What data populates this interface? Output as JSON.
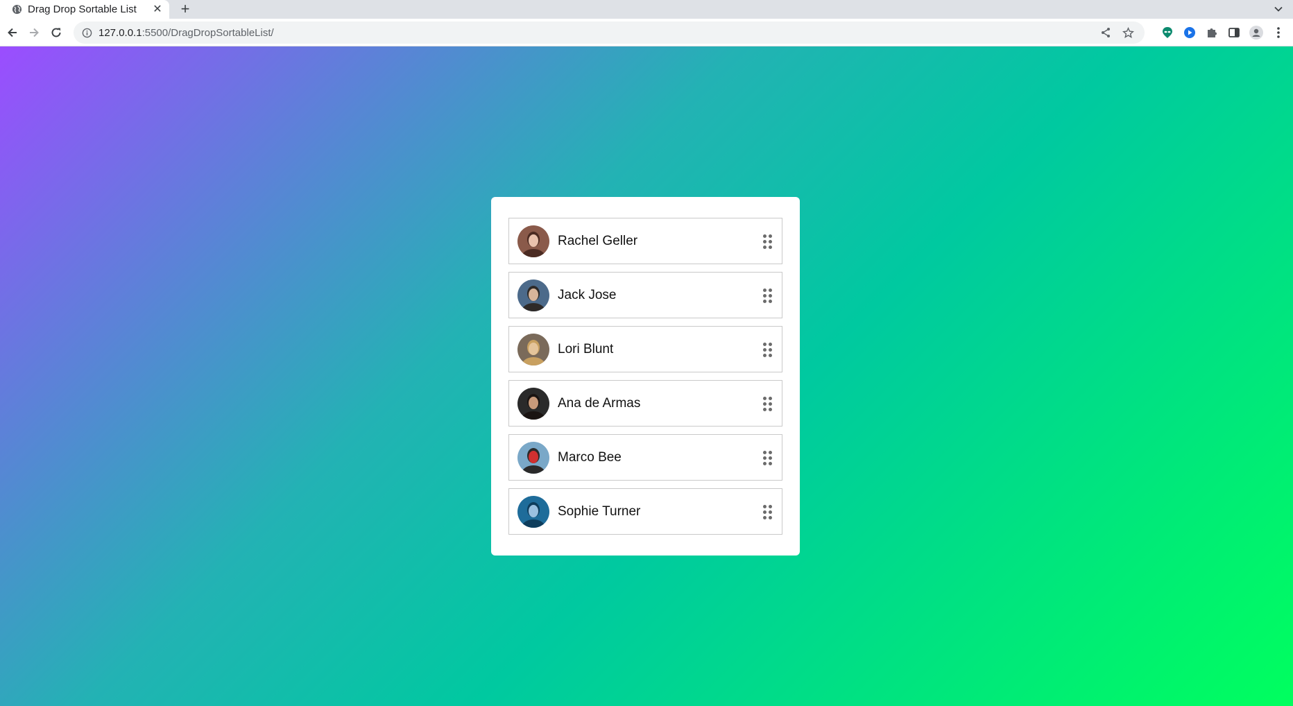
{
  "browser": {
    "tab": {
      "title": "Drag Drop Sortable List",
      "favicon": "globe-icon",
      "close_icon": "close-icon"
    },
    "new_tab_icon": "plus-icon",
    "tab_search_icon": "chevron-down-icon",
    "nav": {
      "back_icon": "arrow-left-icon",
      "forward_icon": "arrow-right-icon",
      "reload_icon": "reload-icon"
    },
    "omnibox": {
      "info_icon": "info-icon",
      "url_host": "127.0.0.1",
      "url_rest": ":5500/DragDropSortableList/",
      "share_icon": "share-icon",
      "star_icon": "star-icon"
    },
    "extensions": [
      "alien-extension-icon",
      "play-extension-icon",
      "puzzle-icon",
      "side-panel-icon",
      "profile-icon",
      "kebab-menu-icon"
    ]
  },
  "page": {
    "background_gradient": [
      "#9b4dff",
      "#23b2b4",
      "#00c9a0",
      "#00ff5e"
    ],
    "list": {
      "items": [
        {
          "name": "Rachel Geller",
          "avatar": "avatar-icon",
          "avatar_colors": [
            "#8a5a4a",
            "#e9c2ad",
            "#4b2b22"
          ]
        },
        {
          "name": "Jack Jose",
          "avatar": "avatar-icon",
          "avatar_colors": [
            "#4c6a8a",
            "#d8b59a",
            "#2e2a28"
          ]
        },
        {
          "name": "Lori Blunt",
          "avatar": "avatar-icon",
          "avatar_colors": [
            "#7a6a5a",
            "#e4c49a",
            "#c8a060"
          ]
        },
        {
          "name": "Ana de Armas",
          "avatar": "avatar-icon",
          "avatar_colors": [
            "#2a2a2a",
            "#c89a7a",
            "#1a1412"
          ]
        },
        {
          "name": "Marco Bee",
          "avatar": "avatar-icon",
          "avatar_colors": [
            "#7aa8c8",
            "#d03030",
            "#2a2a2a"
          ]
        },
        {
          "name": "Sophie Turner",
          "avatar": "avatar-icon",
          "avatar_colors": [
            "#1e6c9a",
            "#9ac0e0",
            "#0e3d5c"
          ]
        }
      ],
      "handle_icon": "drag-handle-icon"
    }
  }
}
